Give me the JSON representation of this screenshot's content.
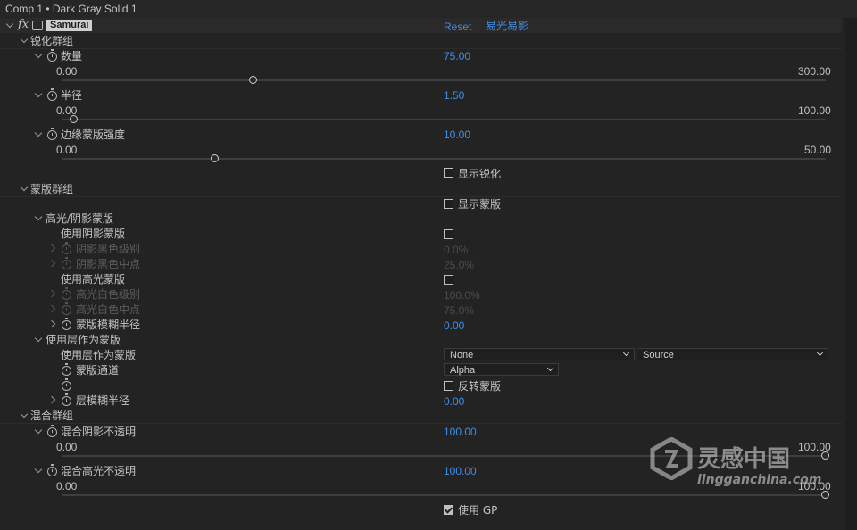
{
  "title_bar": {
    "title": "Comp 1 • Dark Gray Solid 1"
  },
  "effect": {
    "name": "Samurai",
    "reset_label": "Reset",
    "brand_link": "易光易影"
  },
  "groups": {
    "sharpen": {
      "label": "锐化群组",
      "amount": {
        "label": "数量",
        "value": "75.00",
        "min": "0.00",
        "max": "300.00",
        "slider_fraction": 0.25
      },
      "radius": {
        "label": "半径",
        "value": "1.50",
        "min": "0.00",
        "max": "100.00",
        "slider_fraction": 0.015
      },
      "edge_mask": {
        "label": "边缘蒙版强度",
        "value": "10.00",
        "min": "0.00",
        "max": "50.00",
        "slider_fraction": 0.2
      },
      "show_sharpen": {
        "label": "显示锐化",
        "checked": false
      }
    },
    "mask": {
      "label": "蒙版群组",
      "show_mask": {
        "label": "显示蒙版",
        "checked": false
      },
      "hl_shadow": {
        "label": "高光/阴影蒙版",
        "use_shadow": {
          "label": "使用阴影蒙版",
          "checked": false
        },
        "shadow_black": {
          "label": "阴影黑色级别",
          "value": "0.0%"
        },
        "shadow_mid": {
          "label": "阴影黑色中点",
          "value": "25.0%"
        },
        "use_highlight": {
          "label": "使用高光蒙版",
          "checked": false
        },
        "highlight_white": {
          "label": "高光白色级别",
          "value": "100.0%"
        },
        "highlight_mid": {
          "label": "高光白色中点",
          "value": "75.0%"
        },
        "mask_blur": {
          "label": "蒙版模糊半径",
          "value": "0.00"
        }
      },
      "layer_mask": {
        "label": "使用层作为蒙版",
        "use_layer": {
          "label": "使用层作为蒙版",
          "layer_select": "None",
          "source_select": "Source"
        },
        "channel": {
          "label": "蒙版通道",
          "select": "Alpha"
        },
        "invert": {
          "label": "反转蒙版",
          "checked": false
        },
        "layer_blur": {
          "label": "层模糊半径",
          "value": "0.00"
        }
      }
    },
    "blend": {
      "label": "混合群组",
      "shadow_opacity": {
        "label": "混合阴影不透明",
        "value": "100.00",
        "min": "0.00",
        "max": "100.00",
        "slider_fraction": 1.0
      },
      "highlight_opacity": {
        "label": "混合高光不透明",
        "value": "100.00",
        "min": "0.00",
        "max": "100.00",
        "slider_fraction": 1.0
      },
      "use_gp": {
        "label": "使用 GP",
        "checked": true
      }
    }
  },
  "watermark": {
    "cn": "灵感中国",
    "en": "lingganchina.com"
  },
  "colors": {
    "accent": "#3f8fe8",
    "background": "#232323"
  }
}
